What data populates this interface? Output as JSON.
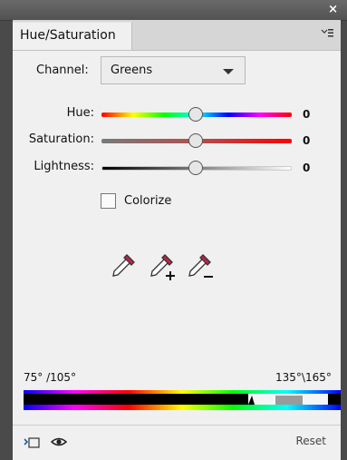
{
  "window": {
    "close_glyph": "×"
  },
  "tab": {
    "title": "Hue/Saturation",
    "menu_icon": "panel-menu-icon"
  },
  "channel": {
    "label": "Channel:",
    "selected": "Greens"
  },
  "sliders": [
    {
      "label": "Hue:",
      "value": "0"
    },
    {
      "label": "Saturation:",
      "value": "0"
    },
    {
      "label": "Lightness:",
      "value": "0"
    }
  ],
  "colorize": {
    "label": "Colorize",
    "checked": false
  },
  "eyedroppers": [
    "eyedropper-icon",
    "eyedropper-plus-icon",
    "eyedropper-minus-icon"
  ],
  "range": {
    "left": "75° /105°",
    "right": "135°\\165°"
  },
  "footer": {
    "reset_label": "Reset"
  }
}
